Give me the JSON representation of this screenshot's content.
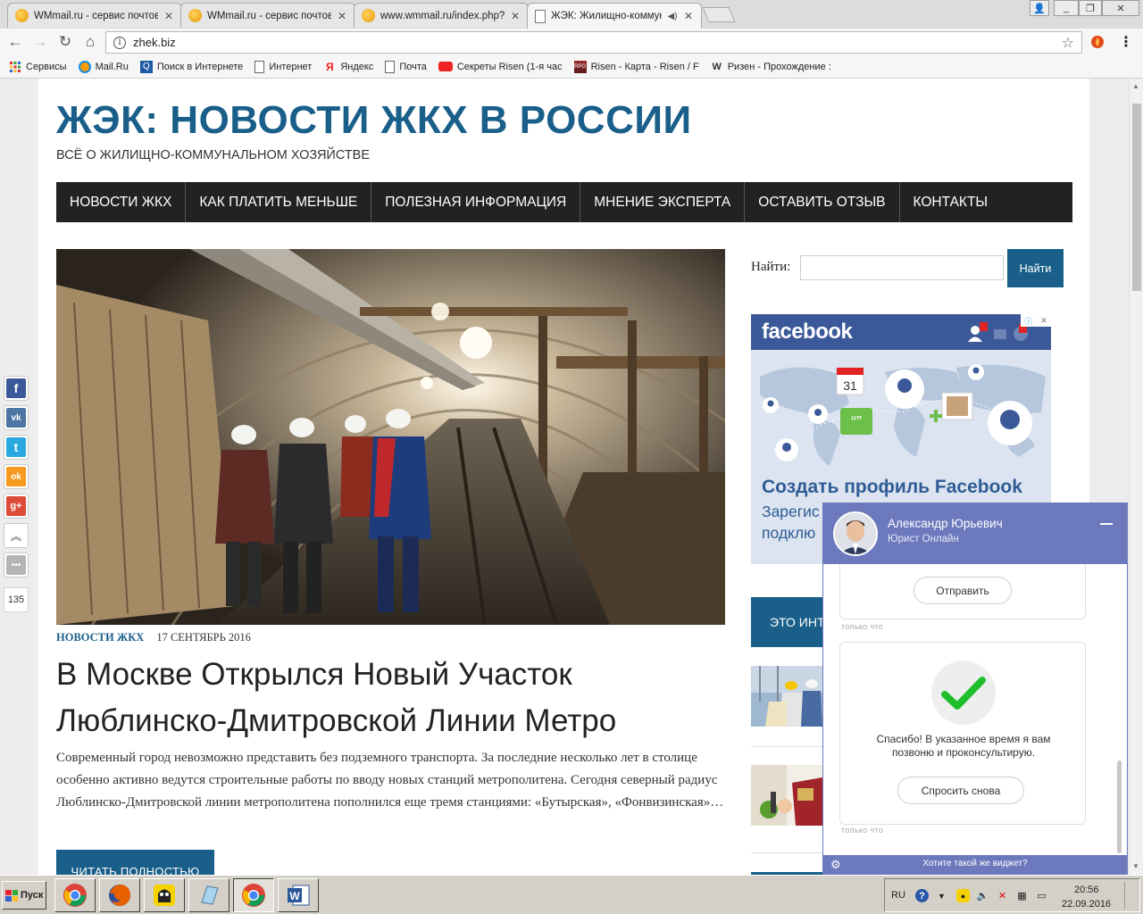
{
  "browser": {
    "tabs": [
      {
        "title": "WMmail.ru - сервис почтов",
        "icon": "wmmail-icon",
        "active": false
      },
      {
        "title": "WMmail.ru - сервис почтов",
        "icon": "wmmail-icon",
        "active": false
      },
      {
        "title": "www.wmmail.ru/index.php?",
        "icon": "wmmail-icon",
        "active": false
      },
      {
        "title": "ЖЭК: Жилищно-коммун",
        "icon": "page-icon",
        "active": true
      }
    ],
    "url": "zhek.biz",
    "bookmarks": [
      {
        "label": "Сервисы",
        "icon": "apps-grid-icon"
      },
      {
        "label": "Mail.Ru",
        "icon": "mailru-icon"
      },
      {
        "label": "Поиск в Интернете",
        "icon": "search-icon"
      },
      {
        "label": "Интернет",
        "icon": "page-icon"
      },
      {
        "label": "Яндекс",
        "icon": "yandex-icon"
      },
      {
        "label": "Почта",
        "icon": "envelope-icon"
      },
      {
        "label": "Секреты Risen (1-я час",
        "icon": "youtube-icon"
      },
      {
        "label": "Risen - Карта - Risen / F",
        "icon": "rpg-icon"
      },
      {
        "label": "Ризен - Прохождение :",
        "icon": "w-icon"
      }
    ]
  },
  "site": {
    "title": "ЖЭК: НОВОСТИ ЖКХ В РОССИИ",
    "tagline": "ВСЁ О ЖИЛИЩНО-КОММУНАЛЬНОМ ХОЗЯЙСТВЕ",
    "nav": [
      "НОВОСТИ ЖКХ",
      "КАК ПЛАТИТЬ МЕНЬШЕ",
      "ПОЛЕЗНАЯ ИНФОРМАЦИЯ",
      "МНЕНИЕ ЭКСПЕРТА",
      "ОСТАВИТЬ ОТЗЫВ",
      "КОНТАКТЫ"
    ]
  },
  "post": {
    "category": "НОВОСТИ ЖКХ",
    "date": "17 СЕНТЯБРЬ 2016",
    "title": "В Москве Открылся Новый Участок Люблинско-Дмитровской Линии Метро",
    "excerpt": "Современный город невозможно представить без подземного транспорта. За последние несколько лет в столице особенно активно ведутся строительные работы по вводу новых станций метрополитена. Сегодня северный радиус Люблинско-Дмитровской линии метрополитена пополнился еще тремя станциями: «Бутырская», «Фонвизинская»…",
    "read_more": "ЧИТАТЬ ПОЛНОСТЬЮ"
  },
  "sidebar": {
    "search_label": "Найти:",
    "search_value": "",
    "search_button": "Найти",
    "ad": {
      "brand": "facebook",
      "calendar_day": "31",
      "cta": "Создать профиль Facebook",
      "sub": "Зарегис подклю"
    },
    "blue_block": "ЭТО ИНТ"
  },
  "share": {
    "buttons": [
      {
        "name": "facebook-share",
        "glyph": "f",
        "color": "#3b5998"
      },
      {
        "name": "vk-share",
        "glyph": "vk",
        "color": "#4c75a3"
      },
      {
        "name": "twitter-share",
        "glyph": "t",
        "color": "#29a9e0"
      },
      {
        "name": "odnoklassniki-share",
        "glyph": "ok",
        "color": "#f59a1e"
      },
      {
        "name": "googleplus-share",
        "glyph": "g+",
        "color": "#dd4b39"
      },
      {
        "name": "scroll-up",
        "glyph": "up",
        "color": "#b5b5b5"
      },
      {
        "name": "more-share",
        "glyph": "more",
        "color": "#b5b5b5"
      }
    ],
    "count": "135"
  },
  "chat": {
    "name": "Александр Юрьевич",
    "role": "Юрист Онлайн",
    "send_button": "Отправить",
    "timestamp": "только что",
    "thanks": "Спасибо! В указанное время я вам позвоню и проконсультирую.",
    "ask_again": "Спросить снова",
    "footer_link": "Хотите такой же виджет?"
  },
  "taskbar": {
    "start": "Пуск",
    "lang": "RU",
    "time": "20:56",
    "date": "22.09.2016"
  },
  "colors": {
    "brand_blue": "#1a5f8a",
    "nav_dark": "#222222",
    "chat_purple": "#6d79bd",
    "facebook": "#3b5998"
  }
}
